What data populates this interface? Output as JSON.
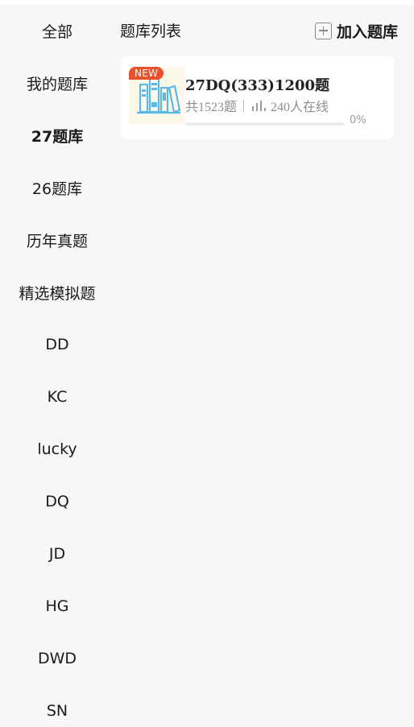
{
  "sidebar": {
    "items": [
      {
        "label": "全部",
        "active": false
      },
      {
        "label": "我的题库",
        "active": false
      },
      {
        "label": "27题库",
        "active": true
      },
      {
        "label": "26题库",
        "active": false
      },
      {
        "label": "历年真题",
        "active": false
      },
      {
        "label": "精选模拟题",
        "active": false
      },
      {
        "label": "DD",
        "active": false
      },
      {
        "label": "KC",
        "active": false
      },
      {
        "label": "lucky",
        "active": false
      },
      {
        "label": "DQ",
        "active": false
      },
      {
        "label": "JD",
        "active": false
      },
      {
        "label": "HG",
        "active": false
      },
      {
        "label": "DWD",
        "active": false
      },
      {
        "label": "SN",
        "active": false
      }
    ]
  },
  "header": {
    "list_title": "题库列表",
    "add_icon": "plus-square-icon",
    "add_label": "加入题库"
  },
  "bank_card": {
    "badge": "NEW",
    "thumbnail_icon": "books-icon",
    "title": "27DQ(333)1200题",
    "question_count": "共1523题",
    "online_icon": "bar-chart-icon",
    "online_count": "240人在线",
    "progress_fraction": 0,
    "progress_text": "0%"
  },
  "colors": {
    "badge": "#e8512b",
    "thumbnail_bg": "#fdf9ea",
    "icon_blue": "#5bb8e6",
    "page_bg": "#f7f7f7"
  }
}
